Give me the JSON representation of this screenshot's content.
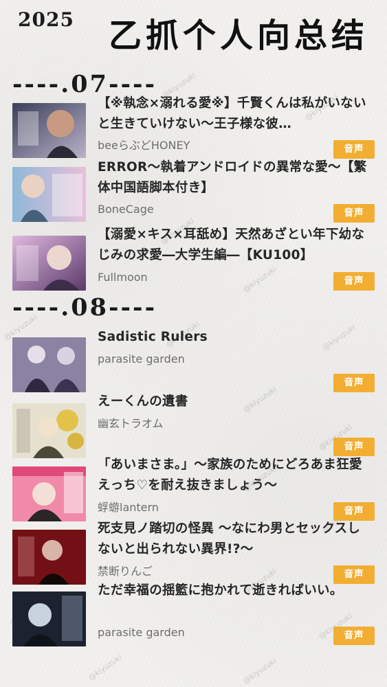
{
  "header": {
    "year": "2025",
    "title": "乙抓个人向总结"
  },
  "months": [
    {
      "label": "----.07----"
    },
    {
      "label": "----.08----"
    }
  ],
  "badge_label": "音声",
  "badge_color": "#f2ae32",
  "watermark": "@kiyuzuki",
  "entries": [
    {
      "title": "【※執念×溺れる愛※】千賢くんは私がいないと生きていけない～王子様な彼…",
      "circle": "beeらぶどHONEY"
    },
    {
      "title": "ERROR～執着アンドロイドの異常な愛～【繁体中国語脚本付き】",
      "circle": "BoneCage"
    },
    {
      "title": "【溺愛×キス×耳舐め】天然あざとい年下幼なじみの求愛―大学生編―【KU100】",
      "circle": "Fullmoon"
    },
    {
      "title": "Sadistic Rulers",
      "circle": "parasite garden"
    },
    {
      "title": "えーくんの遺書",
      "circle": "幽玄トラオム"
    },
    {
      "title": "「あいまさま。」～家族のためにどろあま狂愛えっち♡を耐え抜きましょう～",
      "circle": "蜉蝣lantern"
    },
    {
      "title": "死支見ノ踏切の怪異 ～なにわ男とセックスしないと出られない異界!?～",
      "circle": "禁断りんご"
    },
    {
      "title": "ただ幸福の揺籃に抱かれて逝きればいい。",
      "circle": "parasite garden"
    }
  ]
}
